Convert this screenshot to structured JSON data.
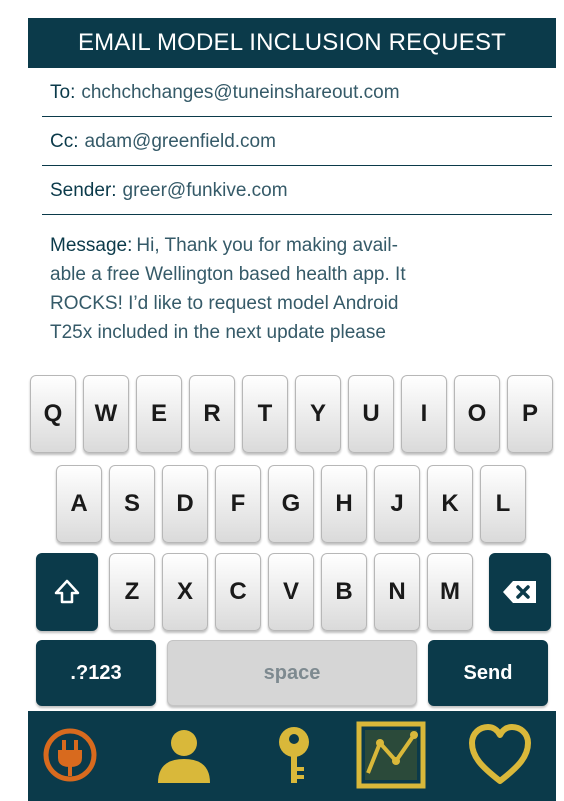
{
  "header": {
    "title": "EMAIL MODEL INCLUSION REQUEST"
  },
  "form": {
    "to": {
      "label": "To:",
      "value": "chchchchanges@tuneinshareout.com"
    },
    "cc": {
      "label": "Cc:",
      "value": "adam@greenfield.com"
    },
    "sender": {
      "label": "Sender:",
      "value": "greer@funkive.com"
    },
    "message": {
      "label": "Message:",
      "line1": "Hi, Thank you for making avail-",
      "line2": "able a free Wellington based health app. It",
      "line3": "ROCKS!  I’d like to request model Android",
      "line4": "T25x included in the next update please"
    }
  },
  "keyboard": {
    "row1": [
      "Q",
      "W",
      "E",
      "R",
      "T",
      "Y",
      "U",
      "I",
      "O",
      "P"
    ],
    "row2": [
      "A",
      "S",
      "D",
      "F",
      "G",
      "H",
      "J",
      "K",
      "L"
    ],
    "row3": [
      "Z",
      "X",
      "C",
      "V",
      "B",
      "N",
      "M"
    ],
    "numbers_label": ".?123",
    "space_label": "space",
    "send_label": "Send",
    "shift_icon": "shift-icon",
    "backspace_icon": "backspace-icon"
  },
  "tabbar": {
    "items": [
      "power-plug-icon",
      "user-icon",
      "key-icon",
      "chart-icon",
      "heart-icon"
    ]
  },
  "colors": {
    "primary": "#0b3a4a",
    "accent_gold": "#d9b83a",
    "accent_orange": "#d86a1e"
  }
}
